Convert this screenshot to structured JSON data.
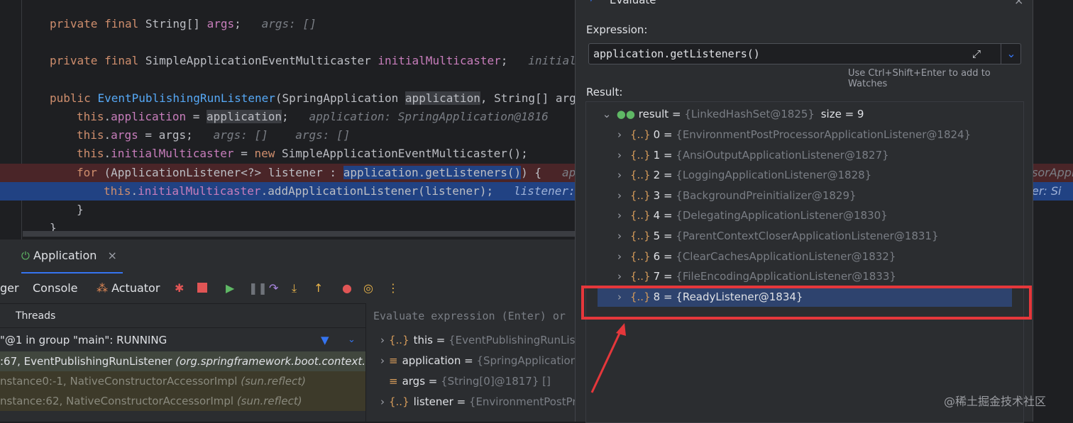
{
  "editor": {
    "lines": [
      {
        "parts": [
          {
            "t": "private final ",
            "c": "kw"
          },
          {
            "t": "String[] ",
            "c": "plain"
          },
          {
            "t": "args",
            "c": "fld"
          },
          {
            "t": ";",
            "c": "plain"
          },
          {
            "t": "   args: []",
            "c": "hint"
          }
        ]
      },
      {
        "parts": [
          {
            "t": "private final ",
            "c": "kw"
          },
          {
            "t": "SimpleApplicationEventMulticaster ",
            "c": "plain"
          },
          {
            "t": "initialMulticaster",
            "c": "fld"
          },
          {
            "t": ";",
            "c": "plain"
          },
          {
            "t": "   initialM",
            "c": "hint"
          }
        ]
      },
      {
        "parts": [
          {
            "t": "public ",
            "c": "kw"
          },
          {
            "t": "EventPublishingRunListener",
            "c": "fn"
          },
          {
            "t": "(SpringApplication ",
            "c": "plain"
          },
          {
            "t": "application",
            "c": "plain hl-param"
          },
          {
            "t": ", String[] args",
            "c": "plain"
          }
        ]
      },
      {
        "parts": [
          {
            "t": "this",
            "c": "kw"
          },
          {
            "t": ".",
            "c": "plain"
          },
          {
            "t": "application",
            "c": "fld"
          },
          {
            "t": " = ",
            "c": "plain"
          },
          {
            "t": "application",
            "c": "plain hl-param"
          },
          {
            "t": ";",
            "c": "plain"
          },
          {
            "t": "   application: SpringApplication@1816",
            "c": "hint"
          }
        ]
      },
      {
        "parts": [
          {
            "t": "this",
            "c": "kw"
          },
          {
            "t": ".",
            "c": "plain"
          },
          {
            "t": "args",
            "c": "fld"
          },
          {
            "t": " = args;",
            "c": "plain"
          },
          {
            "t": "   args: []    args: []",
            "c": "hint"
          }
        ]
      },
      {
        "parts": [
          {
            "t": "this",
            "c": "kw"
          },
          {
            "t": ".",
            "c": "plain"
          },
          {
            "t": "initialMulticaster",
            "c": "fld"
          },
          {
            "t": " = ",
            "c": "plain"
          },
          {
            "t": "new ",
            "c": "kw"
          },
          {
            "t": "SimpleApplicationEventMulticaster();",
            "c": "plain"
          }
        ]
      },
      {
        "parts": [
          {
            "t": "for ",
            "c": "kw"
          },
          {
            "t": "(ApplicationListener<?> listener : ",
            "c": "plain"
          },
          {
            "t": "application.getListeners()",
            "c": "plain sel-text"
          },
          {
            "t": ") {",
            "c": "plain"
          },
          {
            "t": "   appl",
            "c": "hint"
          }
        ]
      },
      {
        "parts": [
          {
            "t": "this",
            "c": "kw"
          },
          {
            "t": ".",
            "c": "plain"
          },
          {
            "t": "initialMulticaster",
            "c": "fld"
          },
          {
            "t": ".addApplicationListener(listener);",
            "c": "plain"
          },
          {
            "t": "   listener: ",
            "c": "hint"
          }
        ]
      },
      {
        "parts": [
          {
            "t": "}",
            "c": "plain"
          }
        ]
      },
      {
        "parts": [
          {
            "t": "}",
            "c": "plain"
          }
        ]
      }
    ],
    "right_overflow_line7": "sorAppl",
    "right_overflow_line8": "er: Si"
  },
  "debug": {
    "tab_label": "Application",
    "tab_close": "×",
    "toolbar": {
      "debugger_label": "ger",
      "console_label": "Console",
      "actuator_label": "Actuator"
    },
    "threads_label": "Threads",
    "thread_status": "\"@1 in group \"main\": RUNNING",
    "frames": [
      {
        "text": ":67, EventPublishingRunListener ",
        "pkg": "(org.springframework.boot.context.e",
        "kind": "cur"
      },
      {
        "text": "nstance0:-1, NativeConstructorAccessorImpl ",
        "pkg": "(sun.reflect)",
        "kind": "lib"
      },
      {
        "text": "nstance:62, NativeConstructorAccessorImpl ",
        "pkg": "(sun.reflect)",
        "kind": "lib"
      }
    ],
    "eval_placeholder": "Evaluate expression (Enter) or",
    "variables": [
      {
        "name": "this",
        "value": "{EventPublishingRunListe",
        "icon": "{..}",
        "expand": true
      },
      {
        "name": "application",
        "value": "{SpringApplication",
        "icon": "≡",
        "expand": true
      },
      {
        "name": "args",
        "value": "{String[0]@1817} []",
        "icon": "≡",
        "expand": false
      },
      {
        "name": "listener",
        "value": "{EnvironmentPostProc",
        "icon": "{..}",
        "expand": true
      }
    ]
  },
  "dialog": {
    "title": "Evaluate",
    "expression_label": "Expression:",
    "expression": "application.getListeners()",
    "hint": "Use Ctrl+Shift+Enter to add to Watches",
    "result_label": "Result:",
    "result_root": {
      "name": "result",
      "value": "{LinkedHashSet@1825}",
      "size": "size = 9"
    },
    "items": [
      {
        "idx": "0",
        "value": "{EnvironmentPostProcessorApplicationListener@1824}"
      },
      {
        "idx": "1",
        "value": "{AnsiOutputApplicationListener@1827}"
      },
      {
        "idx": "2",
        "value": "{LoggingApplicationListener@1828}"
      },
      {
        "idx": "3",
        "value": "{BackgroundPreinitializer@1829}"
      },
      {
        "idx": "4",
        "value": "{DelegatingApplicationListener@1830}"
      },
      {
        "idx": "5",
        "value": "{ParentContextCloserApplicationListener@1831}"
      },
      {
        "idx": "6",
        "value": "{ClearCachesApplicationListener@1832}"
      },
      {
        "idx": "7",
        "value": "{FileEncodingApplicationListener@1833}"
      },
      {
        "idx": "8",
        "value": "{ReadyListener@1834}"
      }
    ]
  },
  "watermark": "@稀土掘金技术社区",
  "colors": {
    "accent": "#e5373b",
    "selection": "#2e436e"
  }
}
